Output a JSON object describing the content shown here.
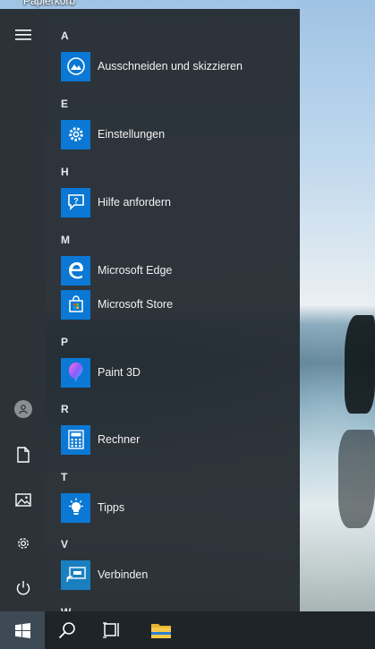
{
  "desktop": {
    "recycle_bin_label": "Papierkorb"
  },
  "start_menu": {
    "sections": [
      {
        "letter": "A",
        "apps": [
          {
            "label": "Ausschneiden und skizzieren",
            "icon": "snip-sketch-icon"
          }
        ]
      },
      {
        "letter": "E",
        "apps": [
          {
            "label": "Einstellungen",
            "icon": "gear-icon"
          }
        ]
      },
      {
        "letter": "H",
        "apps": [
          {
            "label": "Hilfe anfordern",
            "icon": "help-chat-icon"
          }
        ]
      },
      {
        "letter": "M",
        "apps": [
          {
            "label": "Microsoft Edge",
            "icon": "edge-icon"
          },
          {
            "label": "Microsoft Store",
            "icon": "store-bag-icon"
          }
        ]
      },
      {
        "letter": "P",
        "apps": [
          {
            "label": "Paint 3D",
            "icon": "paint3d-icon"
          }
        ]
      },
      {
        "letter": "R",
        "apps": [
          {
            "label": "Rechner",
            "icon": "calculator-icon"
          }
        ]
      },
      {
        "letter": "T",
        "apps": [
          {
            "label": "Tipps",
            "icon": "lightbulb-icon"
          }
        ]
      },
      {
        "letter": "V",
        "apps": [
          {
            "label": "Verbinden",
            "icon": "cast-icon"
          }
        ]
      },
      {
        "letter": "W",
        "apps": []
      }
    ],
    "rail_icons": [
      "hamburger-icon",
      "user-icon",
      "document-icon",
      "pictures-icon",
      "gear-icon",
      "power-icon"
    ]
  },
  "taskbar": {
    "icons": [
      "windows-logo-icon",
      "search-icon",
      "task-view-icon",
      "file-explorer-icon"
    ]
  },
  "colors": {
    "tile_blue": "#0a78d4",
    "menu_bg": "#262d33",
    "taskbar_bg": "#1f2428"
  }
}
